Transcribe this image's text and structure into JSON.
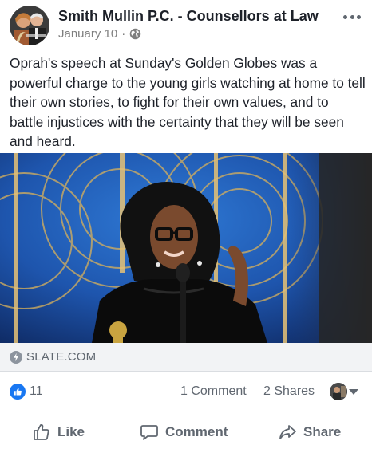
{
  "post": {
    "page_name": "Smith Mullin P.C. - Counsellors at Law",
    "date": "January 10",
    "separator": "·",
    "privacy_icon": "globe-icon",
    "more_icon": "more-options-icon",
    "text": "Oprah's speech at Sunday's Golden Globes was a powerful charge to the young girls watching at home to tell their own stories, to fight for their own values, and to battle injustices with the certainty that they will be seen and heard."
  },
  "link_preview": {
    "source": "SLATE.COM",
    "source_icon": "bolt-icon"
  },
  "stats": {
    "likes": "11",
    "comments": "1 Comment",
    "shares": "2 Shares"
  },
  "actions": {
    "like": "Like",
    "comment": "Comment",
    "share": "Share"
  },
  "colors": {
    "facebook_blue": "#1877f2",
    "secondary_text": "#606770",
    "primary_text": "#1d2129",
    "divider": "#dadde1",
    "source_bar": "#f2f3f5"
  }
}
